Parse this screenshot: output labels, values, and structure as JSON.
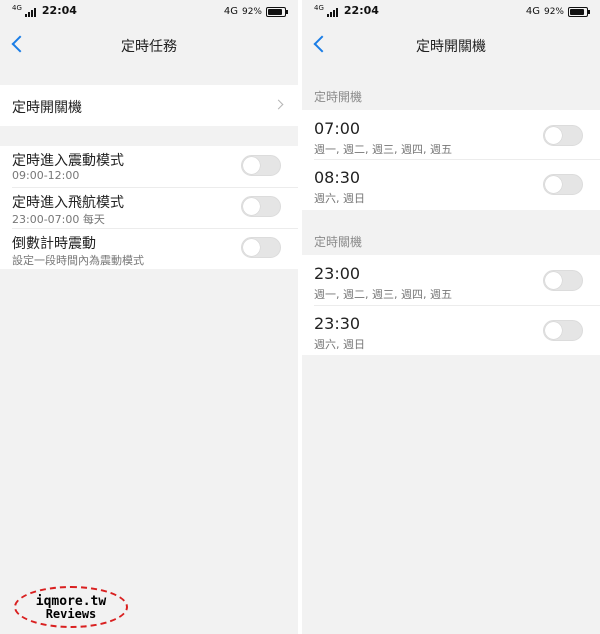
{
  "left": {
    "status": {
      "net_small": "4G",
      "time": "22:04",
      "net": "4G",
      "battery": "92%",
      "battery_level": 0.92
    },
    "title": "定時任務",
    "menu_item": {
      "label": "定時開關機"
    },
    "toggles": [
      {
        "label": "定時進入震動模式",
        "sub": "09:00-12:00",
        "on": false
      },
      {
        "label": "定時進入飛航模式",
        "sub": "23:00-07:00 每天",
        "on": false
      },
      {
        "label": "倒數計時震動",
        "sub": "設定一段時間內為震動模式",
        "on": false
      }
    ],
    "watermark": {
      "line1": "iqmore.tw",
      "line2": "Reviews"
    }
  },
  "right": {
    "status": {
      "net_small": "4G",
      "time": "22:04",
      "net": "4G",
      "battery": "92%",
      "battery_level": 0.92
    },
    "title": "定時開關機",
    "sections": [
      {
        "header": "定時開機",
        "items": [
          {
            "time": "07:00",
            "days": "週一, 週二, 週三, 週四, 週五",
            "on": false
          },
          {
            "time": "08:30",
            "days": "週六, 週日",
            "on": false
          }
        ]
      },
      {
        "header": "定時關機",
        "items": [
          {
            "time": "23:00",
            "days": "週一, 週二, 週三, 週四, 週五",
            "on": false
          },
          {
            "time": "23:30",
            "days": "週六, 週日",
            "on": false
          }
        ]
      }
    ]
  },
  "colors": {
    "accent": "#1a7de6",
    "background": "#f2f2f2",
    "card": "#ffffff",
    "toggle_off": "#e5e5e5",
    "watermark_border": "#d92020"
  }
}
